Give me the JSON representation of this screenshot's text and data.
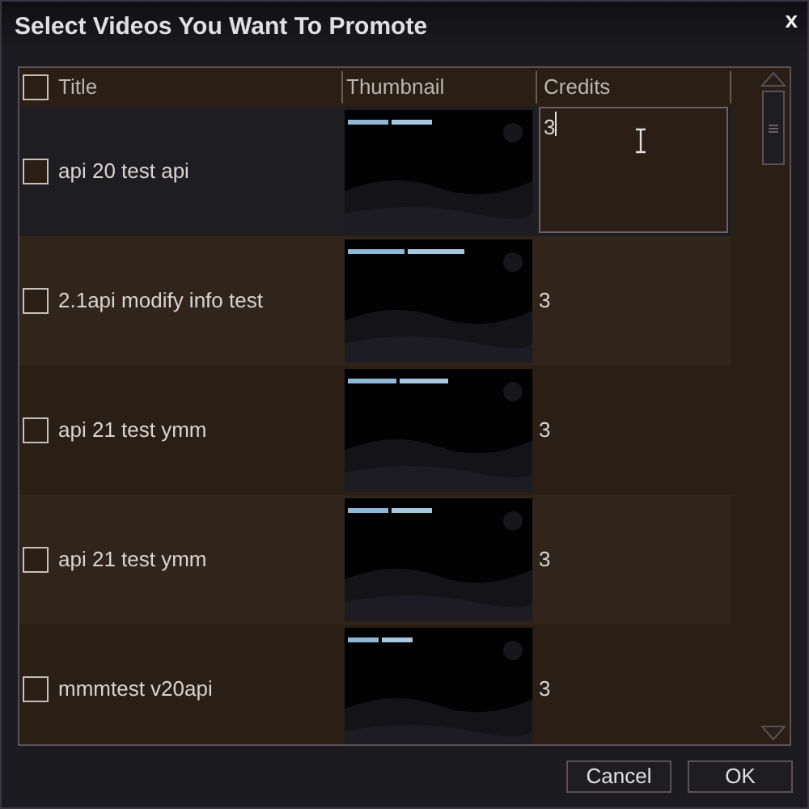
{
  "window": {
    "title": "Select Videos You Want To Promote",
    "close": "x"
  },
  "table": {
    "select_all": {
      "checked": false
    },
    "columns": [
      "Title",
      "Thumbnail",
      "Credits"
    ],
    "rows": [
      {
        "title": "api 20 test api",
        "checked": false,
        "credits": "3",
        "editing": true
      },
      {
        "title": "2.1api modify info test",
        "checked": false,
        "credits": "3",
        "editing": false
      },
      {
        "title": "api 21 test ymm",
        "checked": false,
        "credits": "3",
        "editing": false
      },
      {
        "title": "api 21 test ymm",
        "checked": false,
        "credits": "3",
        "editing": false
      },
      {
        "title": "mmmtest v20api",
        "checked": false,
        "credits": "3",
        "editing": false
      }
    ]
  },
  "buttons": [
    "Cancel",
    "OK"
  ]
}
